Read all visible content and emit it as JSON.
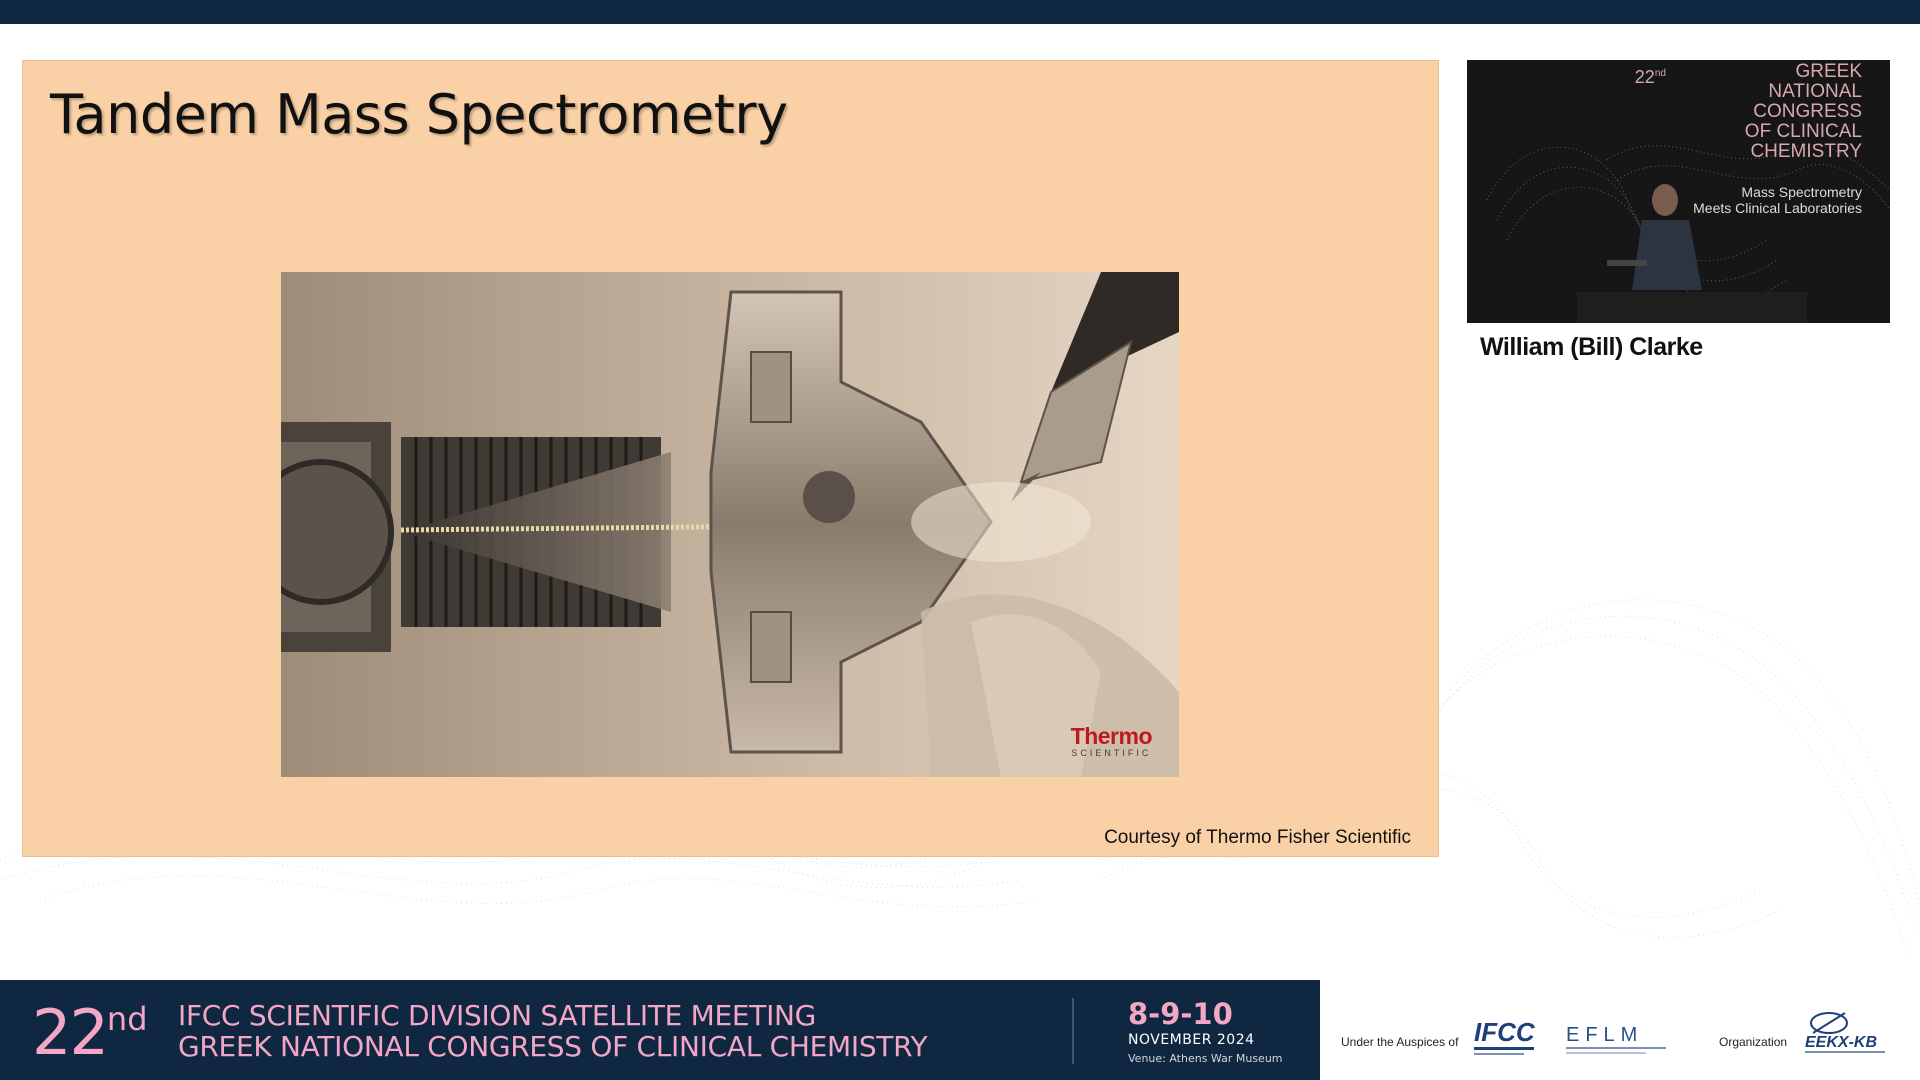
{
  "slide": {
    "title": "Tandem Mass Spectrometry",
    "caption": "Courtesy of Thermo Fisher Scientific",
    "vendor_logo": {
      "name": "Thermo",
      "subtitle": "SCIENTIFIC"
    }
  },
  "camera": {
    "banner": {
      "number": "22",
      "suffix": "nd",
      "line1": "GREEK",
      "line2": "NATIONAL",
      "line3": "CONGRESS",
      "line4": "OF CLINICAL",
      "line5": "CHEMISTRY",
      "sub1": "Mass Spectrometry",
      "sub2": "Meets Clinical Laboratories"
    }
  },
  "speaker": {
    "name": "William (Bill) Clarke"
  },
  "bottom_banner": {
    "number": "22",
    "suffix": "nd",
    "line1": "IFCC SCIENTIFIC DIVISION SATELLITE MEETING",
    "line2": "GREEK NATIONAL CONGRESS OF CLINICAL CHEMISTRY",
    "dates": "8-9-10",
    "month": "NOVEMBER 2024",
    "venue": "Venue: Athens War Museum"
  },
  "sponsors": {
    "auspices_label": "Under the Auspices of",
    "organization_label": "Organization",
    "logos": {
      "ifcc": "IFCC",
      "eflm": "EFLM",
      "ekk": "EEKX-KB"
    }
  },
  "colors": {
    "navy": "#0f2740",
    "pink": "#f3a6c5",
    "slide_bg": "#fad1a6",
    "vendor_red": "#c0181f"
  }
}
